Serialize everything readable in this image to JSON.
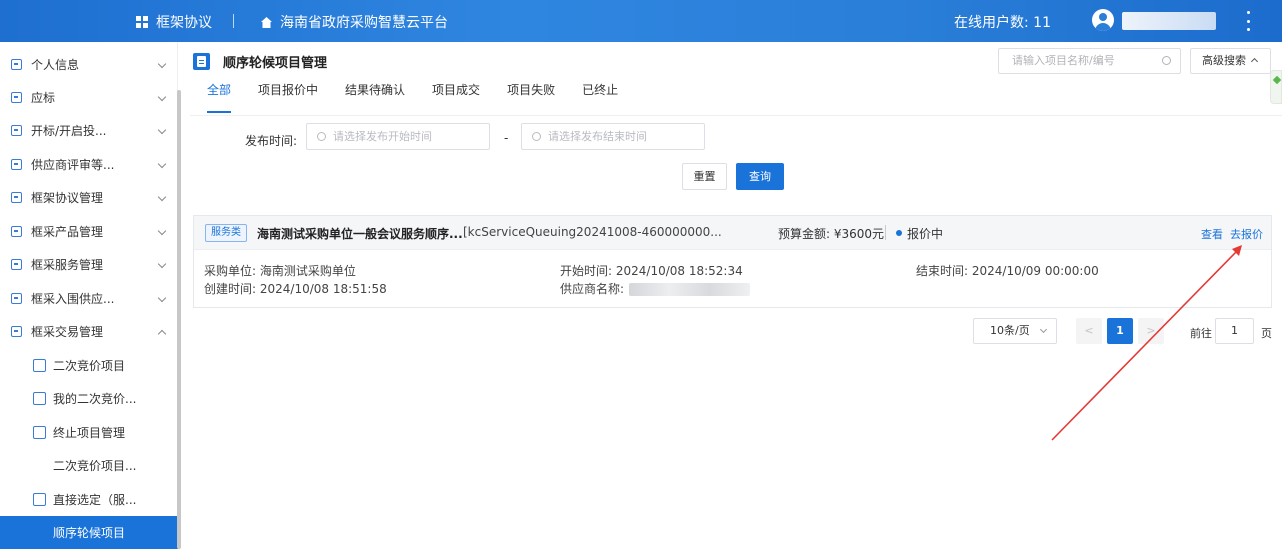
{
  "header": {
    "brand": "框架协议",
    "platform": "海南省政府采购智慧云平台",
    "online_users": "在线用户数: 11"
  },
  "sidebar": {
    "items": [
      {
        "label": "个人信息"
      },
      {
        "label": "应标"
      },
      {
        "label": "开标/开启投..."
      },
      {
        "label": "供应商评审等..."
      },
      {
        "label": "框架协议管理"
      },
      {
        "label": "框采产品管理"
      },
      {
        "label": "框采服务管理"
      },
      {
        "label": "框采入围供应..."
      },
      {
        "label": "框采交易管理"
      }
    ],
    "sub_items": [
      {
        "label": "二次竞价项目"
      },
      {
        "label": "我的二次竞价..."
      },
      {
        "label": "终止项目管理"
      },
      {
        "label": "二次竞价项目..."
      },
      {
        "label": "直接选定（服..."
      },
      {
        "label": "顺序轮候项目"
      }
    ]
  },
  "main": {
    "title": "顺序轮候项目管理",
    "search_placeholder": "请输入项目名称/编号",
    "advanced_search": "高级搜索",
    "tabs": [
      "全部",
      "项目报价中",
      "结果待确认",
      "项目成交",
      "项目失败",
      "已终止"
    ],
    "filter": {
      "label": "发布时间:",
      "start_placeholder": "请选择发布开始时间",
      "end_placeholder": "请选择发布结束时间",
      "separator": "-",
      "reset": "重置",
      "query": "查询"
    },
    "project": {
      "tag": "服务类",
      "name": "海南测试采购单位一般会议服务顺序...",
      "code": "[kcServiceQueuing20241008-460000000...",
      "budget": "预算金额: ¥3600元",
      "status": "报价中",
      "view": "查看",
      "quote": "去报价",
      "purchaser": "采购单位: 海南测试采购单位",
      "created": "创建时间: 2024/10/08 18:51:58",
      "start": "开始时间: 2024/10/08 18:52:34",
      "supplier": "供应商名称:",
      "end": "结束时间: 2024/10/09 00:00:00"
    },
    "pager": {
      "page_size": "10条/页",
      "prev": "<",
      "current": "1",
      "next": ">",
      "goto": "前往",
      "goto_value": "1",
      "page_unit": "页"
    }
  },
  "colors": {
    "primary": "#1a73d9",
    "annotation_arrow": "#e53935"
  }
}
